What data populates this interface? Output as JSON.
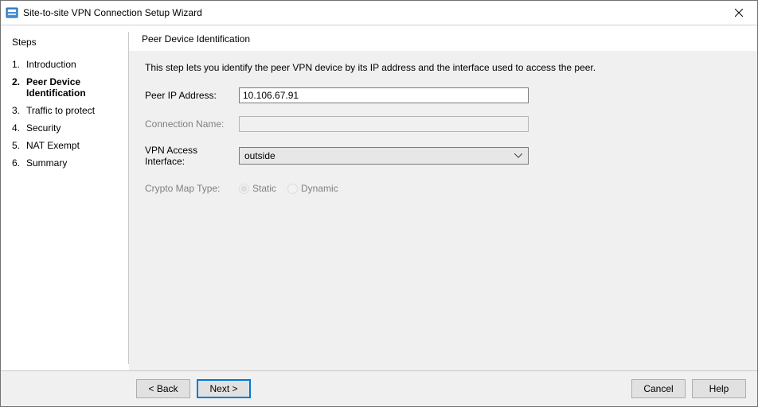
{
  "window": {
    "title": "Site-to-site VPN Connection Setup Wizard"
  },
  "sidebar": {
    "heading": "Steps",
    "items": [
      {
        "num": "1.",
        "label": "Introduction"
      },
      {
        "num": "2.",
        "label": "Peer Device Identification"
      },
      {
        "num": "3.",
        "label": "Traffic to protect"
      },
      {
        "num": "4.",
        "label": "Security"
      },
      {
        "num": "5.",
        "label": "NAT Exempt"
      },
      {
        "num": "6.",
        "label": "Summary"
      }
    ],
    "current_index": 1
  },
  "main": {
    "heading": "Peer Device Identification",
    "description": "This step lets you identify the peer VPN device by its IP address and the interface used to access the peer.",
    "fields": {
      "peer_ip_label": "Peer IP Address:",
      "peer_ip_value": "10.106.67.91",
      "conn_name_label": "Connection Name:",
      "conn_name_value": "",
      "vpn_iface_label": "VPN Access Interface:",
      "vpn_iface_value": "outside",
      "crypto_label": "Crypto Map Type:",
      "crypto_static": "Static",
      "crypto_dynamic": "Dynamic",
      "crypto_selected": "static"
    }
  },
  "footer": {
    "back": "< Back",
    "next": "Next >",
    "cancel": "Cancel",
    "help": "Help"
  }
}
